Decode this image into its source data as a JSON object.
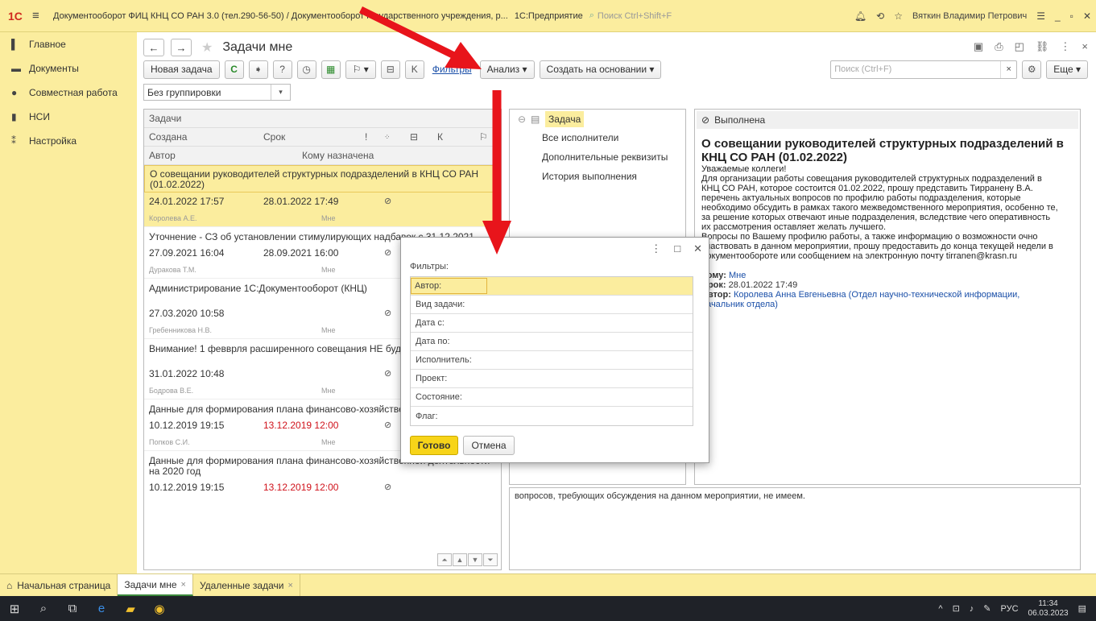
{
  "window": {
    "logo": "1С",
    "title": "Документооборот ФИЦ КНЦ СО РАН 3.0 (тел.290-56-50) / Документооборот государственного учреждения, р...",
    "app_name": "1С:Предприятие",
    "search_placeholder": "Поиск Ctrl+Shift+F",
    "user": "Вяткин Владимир Петрович"
  },
  "sidebar": {
    "items": [
      {
        "label": "Главное"
      },
      {
        "label": "Документы"
      },
      {
        "label": "Совместная работа"
      },
      {
        "label": "НСИ"
      },
      {
        "label": "Настройка"
      }
    ]
  },
  "page": {
    "title": "Задачи мне"
  },
  "toolbar": {
    "new_task": "Новая задача",
    "filters_link": "Фильтры",
    "analysis": "Анализ",
    "create_based": "Создать на основании",
    "search_placeholder": "Поиск (Ctrl+F)",
    "more": "Еще",
    "k_label": "K"
  },
  "grouping": {
    "value": "Без группировки"
  },
  "task_list": {
    "header_title": "Задачи",
    "col_created": "Создана",
    "col_due": "Срок",
    "col_k": "К",
    "col_author": "Автор",
    "col_assignee": "Кому назначена",
    "rows": [
      {
        "title": "О совещании руководителей структурных подразделений в КНЦ СО РАН (01.02.2022)",
        "created": "24.01.2022 17:57",
        "due": "28.01.2022 17:49",
        "author": "Королева А.Е.",
        "assignee": "Мне"
      },
      {
        "title": "Уточнение - СЗ об установлении стимулирующих надбавок с 31.12.2021",
        "created": "27.09.2021 16:04",
        "due": "28.09.2021 16:00",
        "author": "Дуракова Т.М.",
        "assignee": "Мне"
      },
      {
        "title": "Администрирование 1С:Документооборот (КНЦ)",
        "created": "27.03.2020 10:58",
        "due": "",
        "author": "Гребенникова Н.В.",
        "assignee": "Мне"
      },
      {
        "title": "Внимание! 1 февврля расширенного совещания НЕ будет!!",
        "created": "31.01.2022 10:48",
        "due": "",
        "author": "Бодрова В.Е.",
        "assignee": "Мне"
      },
      {
        "title": "Данные для формирования плана финансово-хозяйственно 2020 год",
        "created": "10.12.2019 19:15",
        "due": "13.12.2019 12:00",
        "author": "Попков С.И.",
        "assignee": "Мне"
      },
      {
        "title": "Данные для формирования плана финансово-хозяйственной деятельности на 2020 год",
        "created": "10.12.2019 19:15",
        "due": "13.12.2019 12:00",
        "author": "",
        "assignee": ""
      }
    ]
  },
  "tree": {
    "root": "Задача",
    "items": [
      "Все исполнители",
      "Дополнительные реквизиты",
      "История выполнения"
    ]
  },
  "detail": {
    "status": "Выполнена",
    "heading": "О совещании руководителей структурных подразделений в КНЦ СО РАН (01.02.2022)",
    "body": [
      "Уважаемые коллеги!",
      "Для организации работы совещания руководителей структурных подразделений в",
      "КНЦ СО РАН, которое состоится 01.02.2022, прошу представить Тирранену В.А.",
      "перечень актуальных вопросов по профилю работы подразделения, которые",
      "необходимо обсудить в рамках такого межведомственного мероприятия, особенно те,",
      "за решение которых отвечают иные подразделения, вследствие чего оперативность",
      "их рассмотрения оставляет желать лучшего.",
      "Вопросы по Вашему профилю работы, а также информацию о возможности очно",
      "участвовать в данном мероприятии, прошу предоставить до конца текущей недели в",
      "документообороте или сообщением на электронную почту tirranen@krasn.ru"
    ],
    "to_label": "Кому:",
    "to_value": "Мне",
    "due_label": "Срок:",
    "due_value": "28.01.2022 17:49",
    "author_label": "Автор:",
    "author_value": "Королева Анна Евгеньевна (Отдел научно-технической информации,",
    "author_value2": "начальник отдела)"
  },
  "comment": {
    "text": "вопросов, требующих обсуждения на данном мероприятии, не имеем."
  },
  "filters_dialog": {
    "label": "Фильтры:",
    "fields": [
      "Автор:",
      "Вид задачи:",
      "Дата с:",
      "Дата по:",
      "Исполнитель:",
      "Проект:",
      "Состояние:",
      "Флаг:"
    ],
    "ok": "Готово",
    "cancel": "Отмена"
  },
  "bottom_tabs": {
    "home": "Начальная страница",
    "tabs": [
      "Задачи мне",
      "Удаленные задачи"
    ]
  },
  "taskbar": {
    "lang": "РУС",
    "time": "11:34",
    "date": "06.03.2023"
  },
  "colors": {
    "accent_yellow": "#fbed9e",
    "arrow_red": "#e8141b",
    "overdue_red": "#d0121b",
    "link_blue": "#1a4fa8"
  }
}
